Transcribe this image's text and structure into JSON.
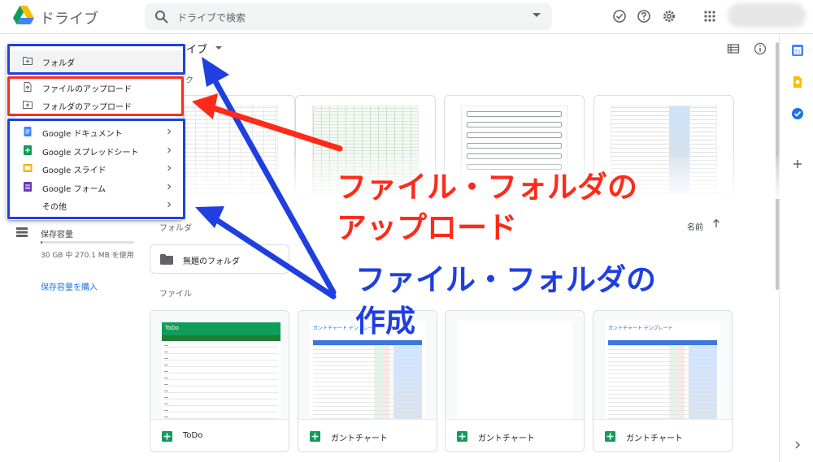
{
  "app": {
    "title": "ドライブ"
  },
  "search": {
    "placeholder": "ドライブで検索"
  },
  "header": {
    "icons": [
      "offline-icon",
      "help-icon",
      "settings-icon",
      "apps-grid-icon"
    ]
  },
  "breadcrumb": {
    "label": "イブ"
  },
  "main": {
    "quick_access_label": "ク",
    "folders_label": "フォルダ",
    "files_label": "ファイル",
    "sort_label": "名前",
    "folder": {
      "name": "無題のフォルダ"
    },
    "files": [
      {
        "name": "ToDo",
        "thumb_title": "ToDo"
      },
      {
        "name": "ガントチャート",
        "thumb_title": "ガントチャート テンプレート"
      },
      {
        "name": "ガントチャート",
        "thumb_title": ""
      },
      {
        "name": "ガントチャート",
        "thumb_title": "ガントチャート テンプレート"
      }
    ]
  },
  "sidebar": {
    "storage_label": "保存容量",
    "storage_usage": "30 GB 中 270.1 MB を使用",
    "storage_used_fraction": 0.009,
    "buy_storage": "保存容量を購入"
  },
  "new_menu": {
    "items": [
      {
        "label": "フォルダ",
        "icon": "folder-plus-icon",
        "submenu": false
      },
      {
        "label": "ファイルのアップロード",
        "icon": "file-upload-icon",
        "submenu": false
      },
      {
        "label": "フォルダのアップロード",
        "icon": "folder-upload-icon",
        "submenu": false
      },
      {
        "label": "Google ドキュメント",
        "icon": "google-docs-icon",
        "submenu": true
      },
      {
        "label": "Google スプレッドシート",
        "icon": "google-sheets-icon",
        "submenu": true
      },
      {
        "label": "Google スライド",
        "icon": "google-slides-icon",
        "submenu": true
      },
      {
        "label": "Google フォーム",
        "icon": "google-forms-icon",
        "submenu": true
      },
      {
        "label": "その他",
        "icon": "",
        "submenu": true
      }
    ]
  },
  "annotations": {
    "upload": {
      "line1": "ファイル・フォルダの",
      "line2": "アップロード",
      "color": "#ff2a1a"
    },
    "create": {
      "line1": "ファイル・フォルダの",
      "line2": "作成",
      "color": "#1f3fe0"
    }
  },
  "colors": {
    "accent": "#1a73e8",
    "sheets_green": "#0f9d58",
    "docs_blue": "#4285f4",
    "slides_yellow": "#f4b400",
    "forms_purple": "#673ab7",
    "annotation_red": "#ff2a1a",
    "annotation_blue": "#1f3fe0"
  }
}
